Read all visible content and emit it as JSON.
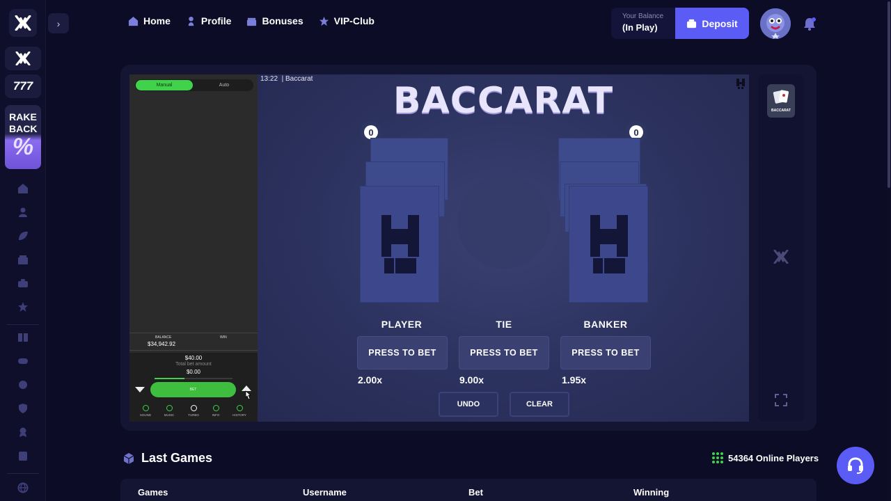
{
  "nav": {
    "items": [
      {
        "label": "Home",
        "icon": "home-icon"
      },
      {
        "label": "Profile",
        "icon": "user-icon"
      },
      {
        "label": "Bonuses",
        "icon": "gift-icon"
      },
      {
        "label": "VIP-Club",
        "icon": "star-icon"
      }
    ]
  },
  "wallet": {
    "balance_label": "Your Balance",
    "balance_value": "(In Play)",
    "deposit_label": "Deposit"
  },
  "sidebar": {
    "brand_777": "777",
    "rakeback_label": "RAKE BACK"
  },
  "panel": {
    "mode_manual": "Manual",
    "mode_auto": "Auto",
    "balance_label": "BALANCE",
    "balance_value": "$34,942.92",
    "win_label": "WIN",
    "bet_amount": "$40.00",
    "total_bet_label": "Total bet amount",
    "total_bet_value": "$0.00",
    "bet_button": "BET",
    "progress_fraction": 0.38,
    "tools": [
      "SOUND",
      "MUSIC",
      "TURBO",
      "INFO",
      "HISTORY"
    ]
  },
  "table": {
    "header_time": "13:22",
    "header_game": "Baccarat",
    "title": "BACCARAT",
    "player_score": "0",
    "banker_score": "0",
    "bets": [
      {
        "label": "PLAYER",
        "button": "PRESS TO BET",
        "multiplier": "2.00x"
      },
      {
        "label": "TIE",
        "button": "PRESS TO BET",
        "multiplier": "9.00x"
      },
      {
        "label": "BANKER",
        "button": "PRESS TO BET",
        "multiplier": "1.95x"
      }
    ],
    "undo": "UNDO",
    "clear": "CLEAR"
  },
  "right_panel": {
    "thumb_label": "BACCARAT"
  },
  "last_games": {
    "title": "Last Games",
    "online_players": "54364 Online Players",
    "columns": [
      "Games",
      "Username",
      "Bet",
      "Winning"
    ]
  },
  "colors": {
    "accent": "#5a5cf5",
    "green": "#3fd24a",
    "background": "#0c0c26"
  }
}
